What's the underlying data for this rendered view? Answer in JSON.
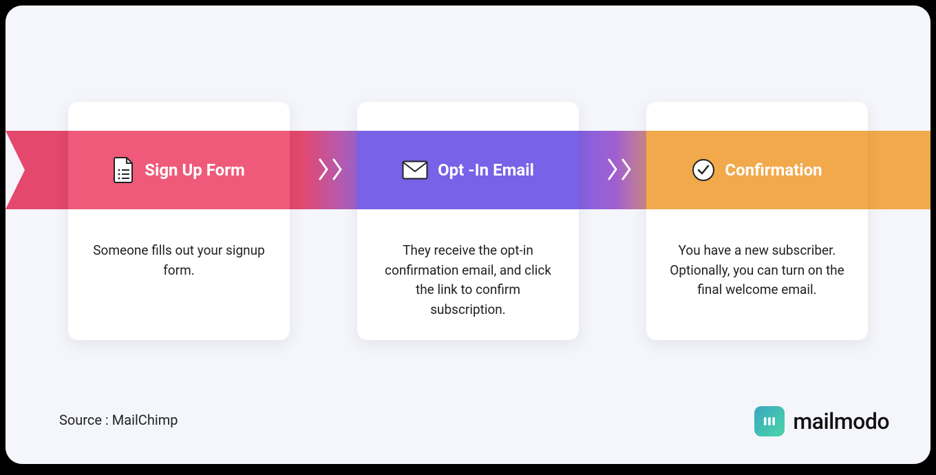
{
  "steps": [
    {
      "title": "Sign Up Form",
      "icon": "form-icon",
      "body": "Someone fills out your signup form."
    },
    {
      "title": "Opt -In Email",
      "icon": "envelope-icon",
      "body": "They receive the opt-in confirmation email, and click the link to confirm subscription."
    },
    {
      "title": "Confirmation",
      "icon": "check-circle-icon",
      "body": "You have a new subscriber. Optionally, you can turn on the final welcome email."
    }
  ],
  "source_label": "Source : MailChimp",
  "brand": "mailmodo",
  "colors": {
    "step1": "#ef5a7a",
    "step2": "#7762e8",
    "step3": "#f1a94c",
    "bg": "#f5f6fb"
  }
}
